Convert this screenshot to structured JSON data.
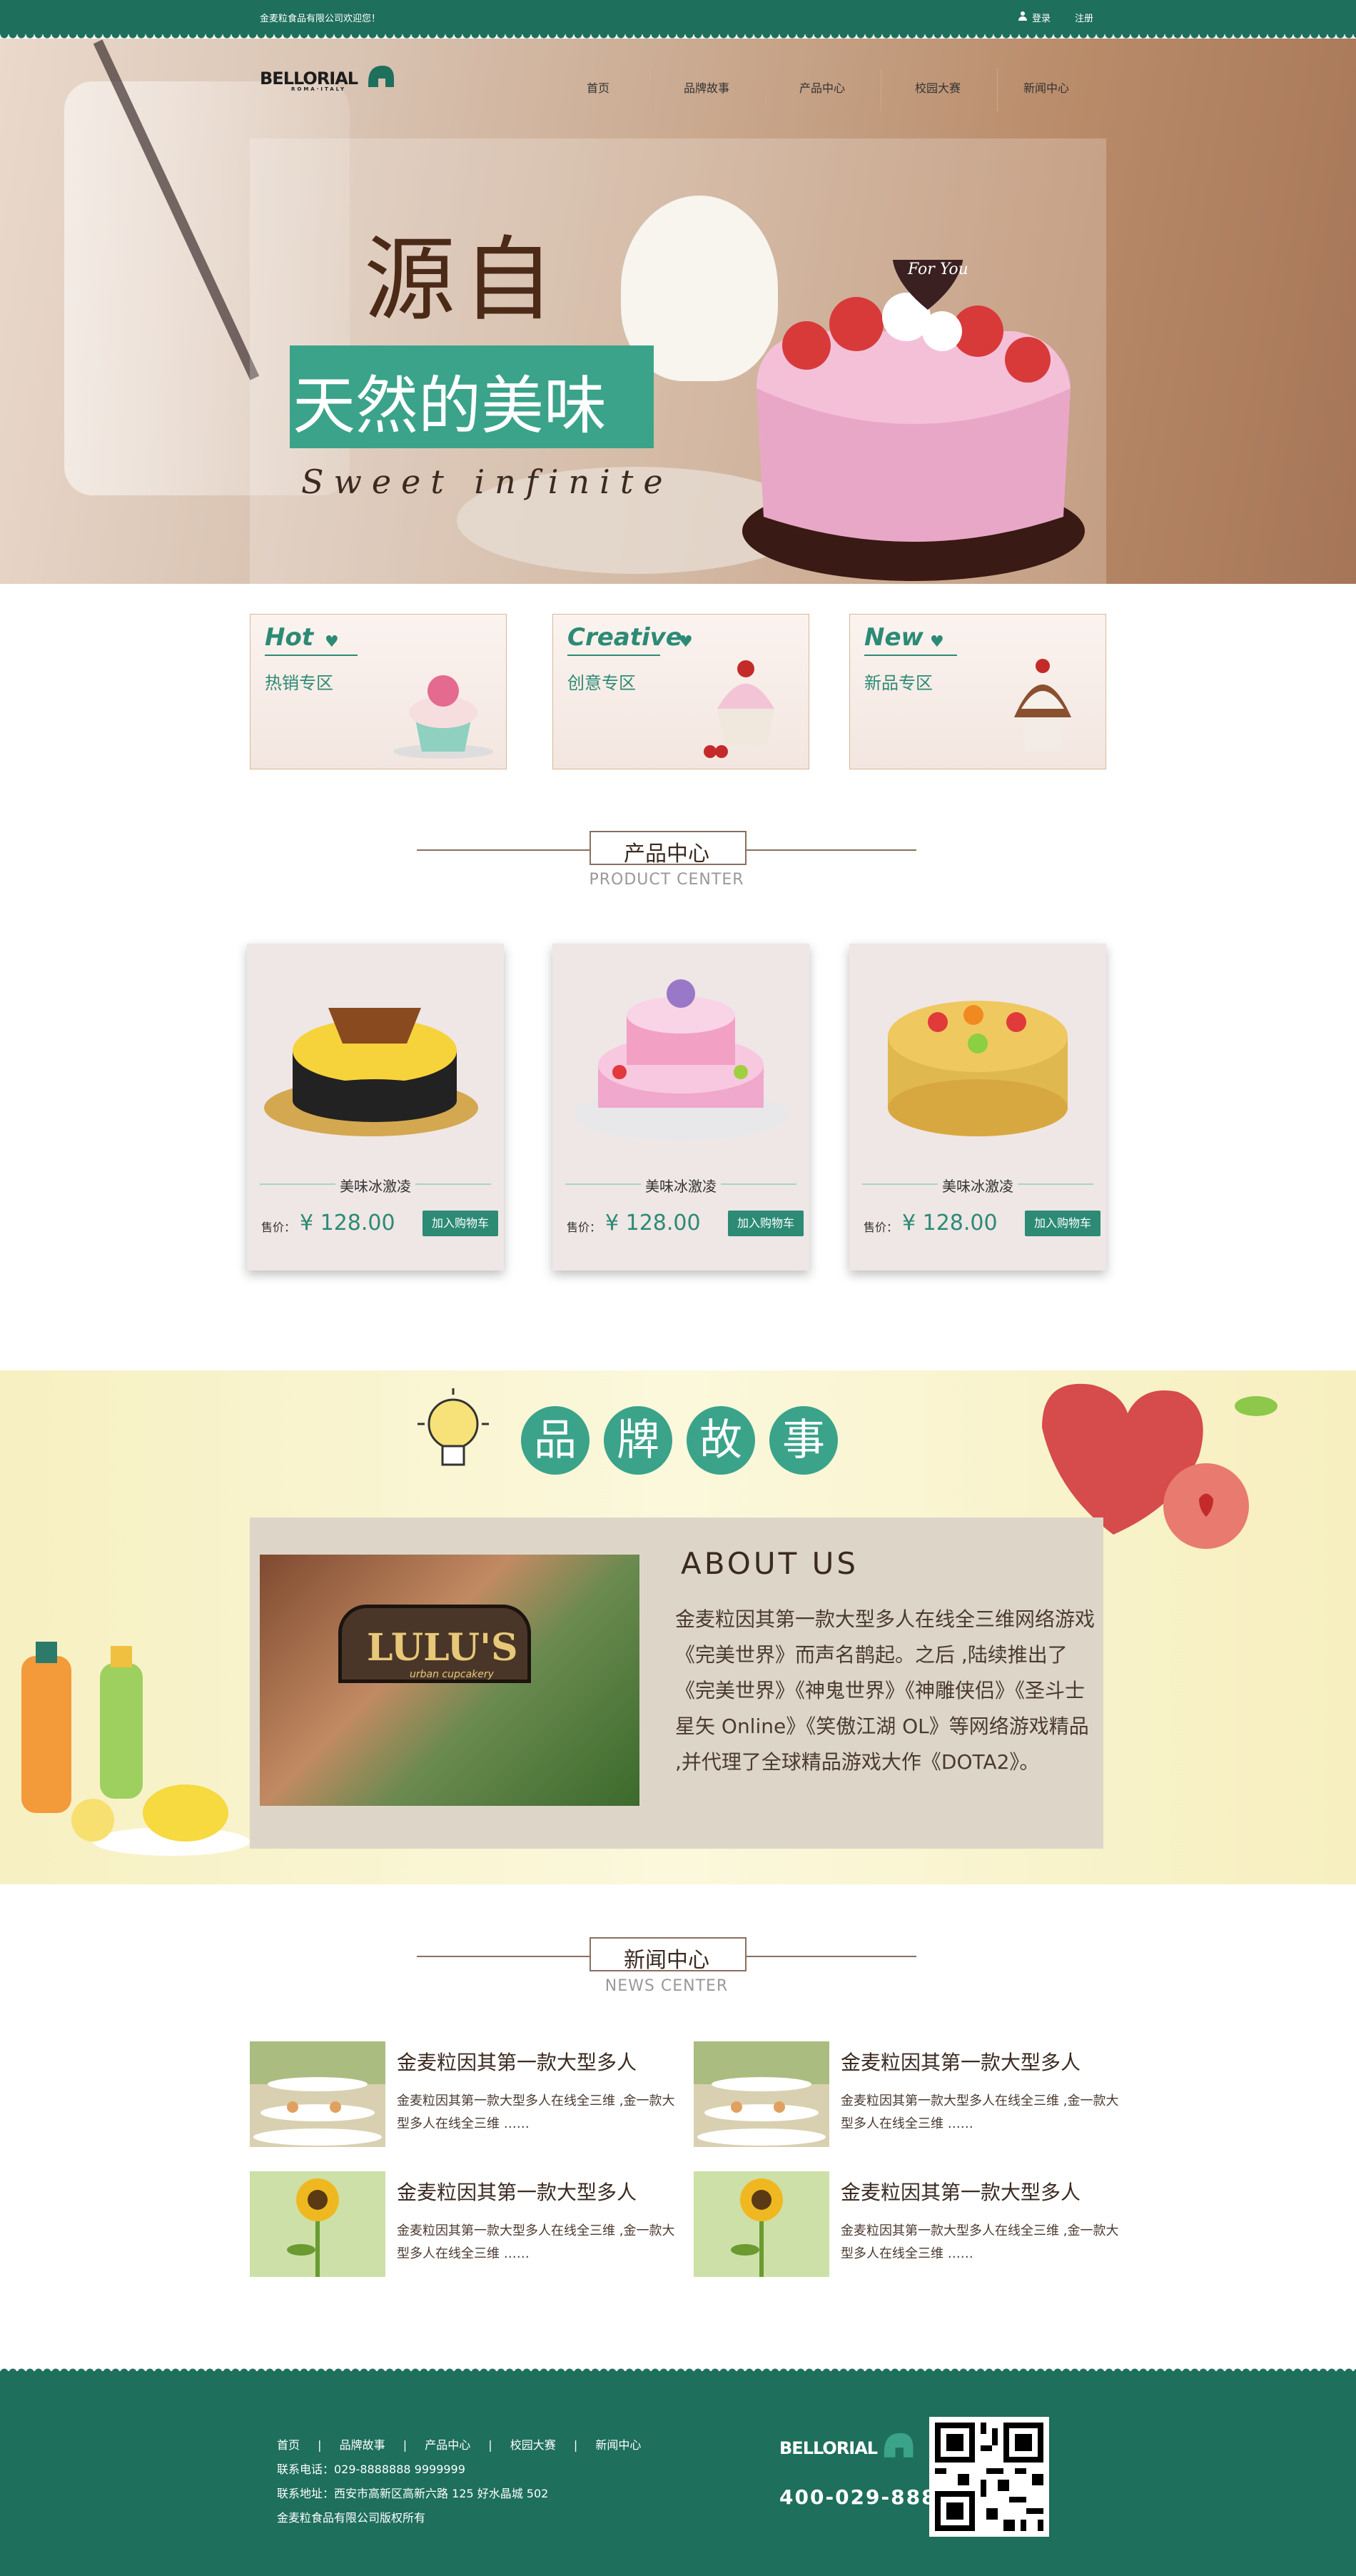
{
  "topbar": {
    "welcome": "金麦粒食品有限公司欢迎您！",
    "login": "登录",
    "register": "注册"
  },
  "brand": {
    "name": "BELLORIAL",
    "tagline": "ROMA·ITALY"
  },
  "nav": [
    {
      "label": "首页"
    },
    {
      "label": "品牌故事"
    },
    {
      "label": "产品中心"
    },
    {
      "label": "校园大赛"
    },
    {
      "label": "新闻中心"
    }
  ],
  "hero": {
    "line1": "源自",
    "line2": "天然的美味",
    "line3": "Sweet infinite",
    "cake_tag": "For You"
  },
  "categories": [
    {
      "en": "Hot",
      "cn": "热销专区"
    },
    {
      "en": "Creative",
      "cn": "创意专区"
    },
    {
      "en": "New",
      "cn": "新品专区"
    }
  ],
  "product_section": {
    "title": "产品中心",
    "subtitle": "PRODUCT CENTER"
  },
  "products": [
    {
      "name": "美味冰激凌",
      "price_label": "售价：",
      "price": "¥ 128.00",
      "button": "加入购物车"
    },
    {
      "name": "美味冰激凌",
      "price_label": "售价：",
      "price": "¥ 128.00",
      "button": "加入购物车"
    },
    {
      "name": "美味冰激凌",
      "price_label": "售价：",
      "price": "¥ 128.00",
      "button": "加入购物车"
    }
  ],
  "brand_story": {
    "chars": [
      "品",
      "牌",
      "故",
      "事"
    ],
    "about_title": "ABOUT US",
    "about_text": "金麦粒因其第一款大型多人在线全三维网络游戏《完美世界》而声名鹊起。之后 ,陆续推出了《完美世界》《神鬼世界》《神雕侠侣》《圣斗士星矢 Online》《笑傲江湖 OL》等网络游戏精品 ,并代理了全球精品游戏大作《DOTA2》。",
    "store_sign": "LULU'S",
    "store_sub": "urban cupcakery"
  },
  "news_section": {
    "title": "新闻中心",
    "subtitle": "NEWS CENTER"
  },
  "news": [
    {
      "title": "金麦粒因其第一款大型多人",
      "desc": "金麦粒因其第一款大型多人在线全三维 ,金一款大型多人在线全三维 ……"
    },
    {
      "title": "金麦粒因其第一款大型多人",
      "desc": "金麦粒因其第一款大型多人在线全三维 ,金一款大型多人在线全三维 ……"
    },
    {
      "title": "金麦粒因其第一款大型多人",
      "desc": "金麦粒因其第一款大型多人在线全三维 ,金一款大型多人在线全三维 ……"
    },
    {
      "title": "金麦粒因其第一款大型多人",
      "desc": "金麦粒因其第一款大型多人在线全三维 ,金一款大型多人在线全三维 ……"
    }
  ],
  "footer": {
    "nav": [
      "首页",
      "|",
      "品牌故事",
      "|",
      "产品中心",
      "|",
      "校园大赛",
      "|",
      "新闻中心"
    ],
    "phone_line": "联系电话：029-8888888  9999999",
    "address_line": "联系地址：西安市高新区高新六路 125 好水晶城 502",
    "copyright": "金麦粒食品有限公司版权所有",
    "hotline": "400-029-888"
  },
  "colors": {
    "primary": "#1e6f5c",
    "accent": "#3aa38a",
    "brown": "#3b2a20"
  }
}
